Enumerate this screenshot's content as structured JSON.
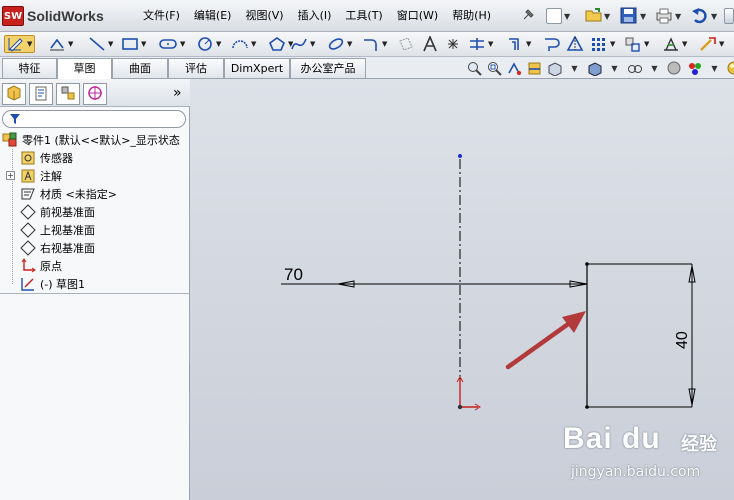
{
  "app": {
    "title": "SolidWorks",
    "logo_text": "SW"
  },
  "menu": [
    "文件(F)",
    "编辑(E)",
    "视图(V)",
    "插入(I)",
    "工具(T)",
    "窗口(W)",
    "帮助(H)"
  ],
  "tabs": [
    {
      "label": "特征",
      "active": false
    },
    {
      "label": "草图",
      "active": true
    },
    {
      "label": "曲面",
      "active": false
    },
    {
      "label": "评估",
      "active": false
    },
    {
      "label": "DimXpert",
      "active": false
    },
    {
      "label": "办公室产品",
      "active": false
    }
  ],
  "panel": {
    "collapse_glyph": "»",
    "tree": [
      {
        "name": "part-node",
        "label": "零件1  (默认<<默认>_显示状态",
        "icon": "part-icon"
      },
      {
        "name": "sensors-node",
        "label": "传感器",
        "icon": "sensor-icon"
      },
      {
        "name": "annotations-node",
        "label": "注解",
        "icon": "annotation-icon",
        "expander": "+"
      },
      {
        "name": "material-node",
        "label": "材质 <未指定>",
        "icon": "material-icon"
      },
      {
        "name": "front-plane-node",
        "label": "前视基准面",
        "icon": "plane-icon"
      },
      {
        "name": "top-plane-node",
        "label": "上视基准面",
        "icon": "plane-icon"
      },
      {
        "name": "right-plane-node",
        "label": "右视基准面",
        "icon": "plane-icon"
      },
      {
        "name": "origin-node",
        "label": "原点",
        "icon": "origin-icon"
      },
      {
        "name": "sketch-node",
        "label": "(-)  草图1",
        "icon": "sketch-icon"
      }
    ]
  },
  "sketch": {
    "dim_horizontal": "70",
    "dim_vertical": "40"
  },
  "watermark": {
    "brand": "Bai du",
    "brand_suffix": "经验",
    "url": "jingyan.baidu.com"
  },
  "colors": {
    "accent": "#c8201c",
    "sketch_line": "#000000",
    "arrow": "#b23a3a",
    "canvas_top": "#dde1e8",
    "canvas_bottom": "#c9ced8"
  }
}
